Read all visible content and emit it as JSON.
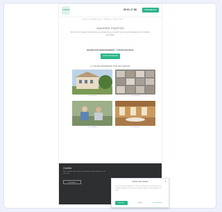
{
  "header": {
    "logo_text": "CHÊNES",
    "phone": "05 61 17 86",
    "cta_label": "PRENDRE RDV"
  },
  "breadcrumb": "Accueil > Nos établissements > Résidence > Galerie photos",
  "main": {
    "title": "GALERIE PHOTOS",
    "intro": "Découvrez en images notre résidence, ses espaces de vie, son jardin et les moments partagés par nos résidents au quotidien.",
    "subtitle": "BESOIN D'UN RENSEIGNEMENT ? CONTACTEZ-NOUS",
    "cta_label": "NOUS CONTACTER",
    "gallery_title": "LA VIE EN RÉSIDENCE PAR LES IMAGES"
  },
  "gallery": [
    {
      "caption": "La résidence"
    },
    {
      "caption": "Les animations"
    },
    {
      "caption": "Les activités"
    },
    {
      "caption": "Le restaurant"
    }
  ],
  "cookie_bar": {
    "title": "Cookies",
    "text": "Nous utilisons des cookies pour améliorer votre expérience sur notre site.",
    "button": "Paramétrer"
  },
  "cookie_modal": {
    "title": "Gestion des cookies",
    "text": "Ce site utilise des cookies pour mesurer l'audience et vous proposer une navigation optimale. Vous pouvez accepter, refuser ou personnaliser vos choix.",
    "accept": "Accepter",
    "reject": "Refuser",
    "customize": "Personnaliser"
  }
}
